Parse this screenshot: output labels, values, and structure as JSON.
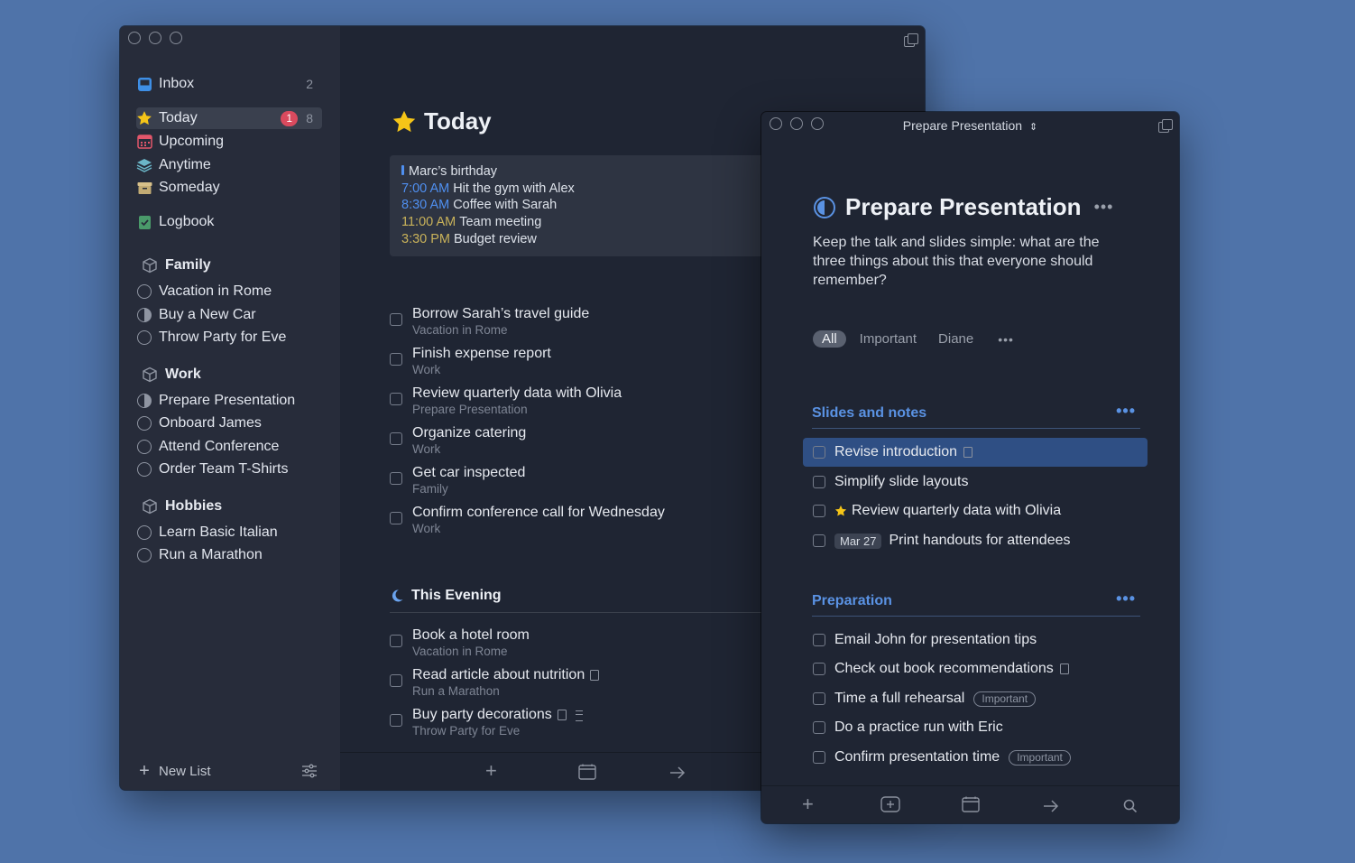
{
  "main_window": {
    "sidebar": {
      "inbox": {
        "label": "Inbox",
        "count": "2"
      },
      "today": {
        "label": "Today",
        "badge": "1",
        "count": "8"
      },
      "upcoming": {
        "label": "Upcoming"
      },
      "anytime": {
        "label": "Anytime"
      },
      "someday": {
        "label": "Someday"
      },
      "logbook": {
        "label": "Logbook"
      },
      "areas": [
        {
          "name": "Family",
          "projects": [
            "Vacation in Rome",
            "Buy a New Car",
            "Throw Party for Eve"
          ]
        },
        {
          "name": "Work",
          "projects": [
            "Prepare Presentation",
            "Onboard James",
            "Attend Conference",
            "Order Team T-Shirts"
          ]
        },
        {
          "name": "Hobbies",
          "projects": [
            "Learn Basic Italian",
            "Run a Marathon"
          ]
        }
      ],
      "new_list_label": "New List"
    },
    "today": {
      "title": "Today",
      "calendar": {
        "all_day": "Marc’s birthday",
        "events": [
          {
            "time": "7:00 AM",
            "title": "Hit the gym with Alex",
            "color": "#4f8ff0"
          },
          {
            "time": "8:30 AM",
            "title": "Coffee with Sarah",
            "color": "#4f8ff0"
          },
          {
            "time": "11:00 AM",
            "title": "Team meeting",
            "color": "#c9b25a"
          },
          {
            "time": "3:30 PM",
            "title": "Budget review",
            "color": "#c9b25a"
          }
        ]
      },
      "tasks": [
        {
          "title": "Borrow Sarah’s travel guide",
          "project": "Vacation in Rome"
        },
        {
          "title": "Finish expense report",
          "project": "Work"
        },
        {
          "title": "Review quarterly data with Olivia",
          "project": "Prepare Presentation"
        },
        {
          "title": "Organize catering",
          "project": "Work"
        },
        {
          "title": "Get car inspected",
          "project": "Family"
        },
        {
          "title": "Confirm conference call for Wednesday",
          "project": "Work"
        }
      ],
      "evening_title": "This Evening",
      "evening_tasks": [
        {
          "title": "Book a hotel room",
          "project": "Vacation in Rome"
        },
        {
          "title": "Read article about nutrition",
          "project": "Run a Marathon",
          "icon": "note-icon"
        },
        {
          "title": "Buy party decorations",
          "project": "Throw Party for Eve",
          "icon": "note-icon"
        }
      ]
    }
  },
  "detail_window": {
    "window_title": "Prepare Presentation",
    "title": "Prepare Presentation",
    "notes": "Keep the talk and slides simple: what are the three things about this that everyone should remember?",
    "filters": [
      "All",
      "Important",
      "Diane"
    ],
    "sections": [
      {
        "title": "Slides and notes",
        "tasks": [
          {
            "title": "Revise introduction",
            "icon": "note-icon",
            "selected": true
          },
          {
            "title": "Simplify slide layouts"
          },
          {
            "title": "Review quarterly data with Olivia",
            "starred": true
          },
          {
            "title": "Print handouts for attendees",
            "date": "Mar 27"
          }
        ]
      },
      {
        "title": "Preparation",
        "tasks": [
          {
            "title": "Email John for presentation tips"
          },
          {
            "title": "Check out book recommendations",
            "icon": "note-icon"
          },
          {
            "title": "Time a full rehearsal",
            "tag": "Important"
          },
          {
            "title": "Do a practice run with Eric"
          },
          {
            "title": "Confirm presentation time",
            "tag": "Important"
          }
        ]
      }
    ]
  },
  "colors": {
    "desktop": "#4f73a9",
    "accent": "#5a92e3",
    "badge": "#d94a5e",
    "star": "#f5c518"
  }
}
